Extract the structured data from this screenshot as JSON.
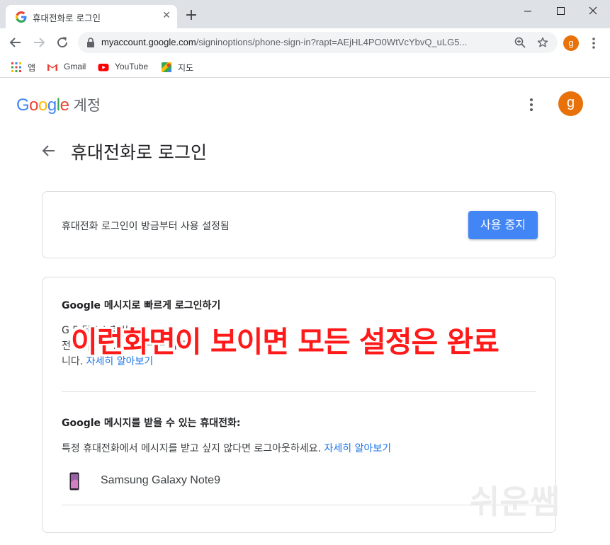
{
  "browser": {
    "tab_title": "휴대전화로 로그인",
    "tab_close": "✕",
    "new_tab": "+",
    "url_host": "myaccount.google.com",
    "url_path": "/signinoptions/phone-sign-in?rapt=AEjHL4PO0WtVcYbvQ_uLG5...",
    "profile_initial": "g",
    "bookmarks": [
      {
        "label": "앱",
        "icon": "apps-grid-icon"
      },
      {
        "label": "Gmail",
        "icon": "gmail-icon"
      },
      {
        "label": "YouTube",
        "icon": "youtube-icon"
      },
      {
        "label": "지도",
        "icon": "maps-icon"
      }
    ]
  },
  "header": {
    "logo_letters": [
      "G",
      "o",
      "o",
      "g",
      "l",
      "e"
    ],
    "logo_colors": [
      "#4285f4",
      "#ea4335",
      "#fbbc05",
      "#4285f4",
      "#34a853",
      "#ea4335"
    ],
    "product": "계정",
    "avatar_initial": "g",
    "avatar_color": "#e8710a"
  },
  "page": {
    "title": "휴대전화로 로그인"
  },
  "status_card": {
    "text": "휴대전화 로그인이 방금부터 사용 설정됨",
    "button_label": "사용 중지",
    "button_color": "#4285f4"
  },
  "messages_card": {
    "heading": "Google 메시지로 빠르게 로그인하기",
    "desc_line1": "G                    5                    담  `                  !                        호      ||",
    "desc_line2": "전              ·      [       |  「     ·      .         ㄴ       하         ㅡ      ㅡ        하             팁",
    "desc_line3_text": "니다. ",
    "desc_line3_link": "자세히 알아보기",
    "phones_heading": "Google 메시지를 받을 수 있는 휴대전화:",
    "phones_desc": "특정 휴대전화에서 메시지를 받고 싶지 않다면 로그아웃하세요. ",
    "phones_link": "자세히 알아보기",
    "device_name": "Samsung Galaxy Note9"
  },
  "overlay": {
    "caption": "이런화면이 보이면 모든 설정은 완료",
    "watermark": "쉬운쌤",
    "caption_color": "#ff1a1a"
  }
}
